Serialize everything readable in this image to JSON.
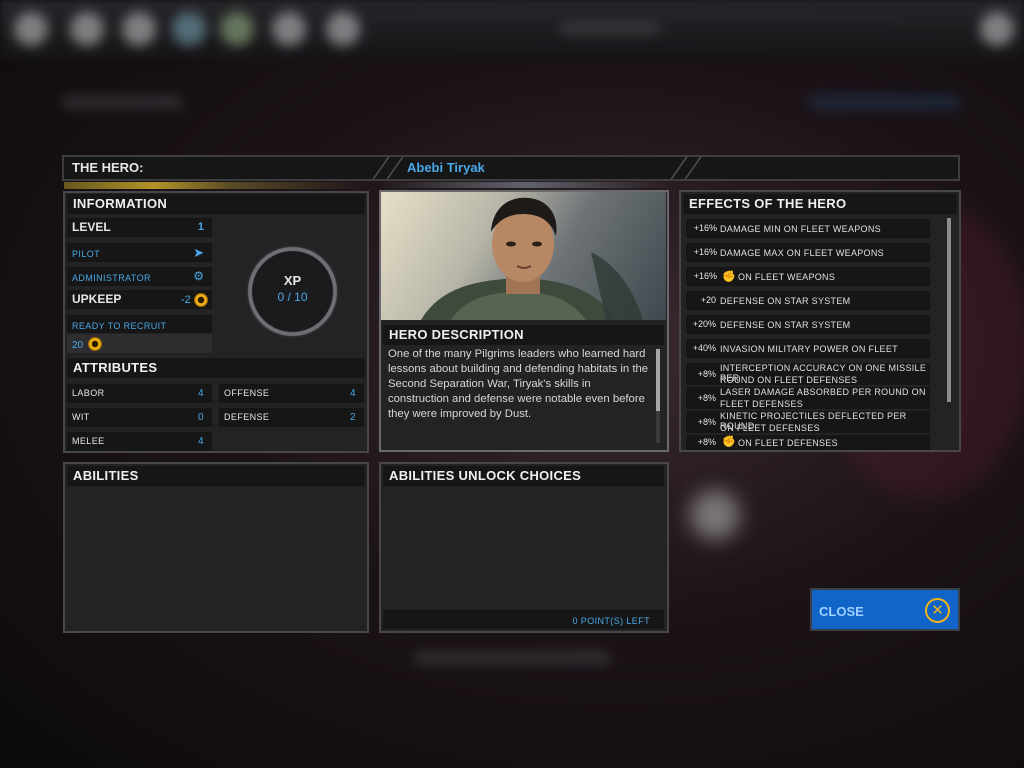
{
  "header": {
    "label": "THE HERO:",
    "hero_name": "Abebi Tiryak"
  },
  "information": {
    "title": "INFORMATION",
    "level_label": "LEVEL",
    "level_value": "1",
    "class_primary": "PILOT",
    "class_secondary": "ADMINISTRATOR",
    "upkeep_label": "UPKEEP",
    "upkeep_value": "-2",
    "recruit_label": "READY TO RECRUIT",
    "recruit_cost": "20",
    "xp_label": "XP",
    "xp_value": "0 / 10"
  },
  "attributes": {
    "title": "ATTRIBUTES",
    "items": [
      {
        "label": "LABOR",
        "value": "4"
      },
      {
        "label": "WIT",
        "value": "0"
      },
      {
        "label": "MELEE",
        "value": "4"
      },
      {
        "label": "OFFENSE",
        "value": "4"
      },
      {
        "label": "DEFENSE",
        "value": "2"
      }
    ]
  },
  "description": {
    "title": "HERO DESCRIPTION",
    "text": "One of the many Pilgrims leaders who learned hard lessons about building and defending habitats in the Second Separation War, Tiryak's skills in construction and defense were notable even before they were improved by Dust."
  },
  "effects": {
    "title": "EFFECTS OF THE HERO",
    "items": [
      {
        "pct": "+16%",
        "line1": "DAMAGE MIN ON FLEET WEAPONS",
        "line2": "",
        "icon": ""
      },
      {
        "pct": "+16%",
        "line1": "DAMAGE MAX ON FLEET WEAPONS",
        "line2": "",
        "icon": ""
      },
      {
        "pct": "+16%",
        "line1": "ON FLEET WEAPONS",
        "line2": "",
        "icon": "fist-icon"
      },
      {
        "pct": "+20",
        "line1": "DEFENSE ON STAR SYSTEM",
        "line2": "",
        "icon": ""
      },
      {
        "pct": "+20%",
        "line1": "DEFENSE ON STAR SYSTEM",
        "line2": "",
        "icon": ""
      },
      {
        "pct": "+40%",
        "line1": "INVASION MILITARY POWER ON FLEET",
        "line2": "",
        "icon": ""
      },
      {
        "pct": "+8%",
        "line1": "INTERCEPTION ACCURACY ON ONE MISSILE PER",
        "line2": "ROUND ON FLEET DEFENSES",
        "icon": ""
      },
      {
        "pct": "+8%",
        "line1": "LASER DAMAGE ABSORBED PER ROUND ON",
        "line2": "FLEET DEFENSES",
        "icon": ""
      },
      {
        "pct": "+8%",
        "line1": "KINETIC PROJECTILES DEFLECTED PER ROUND",
        "line2": "ON FLEET DEFENSES",
        "icon": ""
      },
      {
        "pct": "+8%",
        "line1": "ON FLEET DEFENSES",
        "line2": "",
        "icon": "fist-icon"
      }
    ]
  },
  "abilities": {
    "title": "ABILITIES"
  },
  "unlock": {
    "title": "ABILITIES UNLOCK CHOICES",
    "points_left": "0 POINT(S) LEFT"
  },
  "close_button": {
    "label": "CLOSE"
  },
  "colors": {
    "accent_blue": "#4aa8e8",
    "close_bg": "#1164c8",
    "dust_gold": "#f0b21a"
  }
}
